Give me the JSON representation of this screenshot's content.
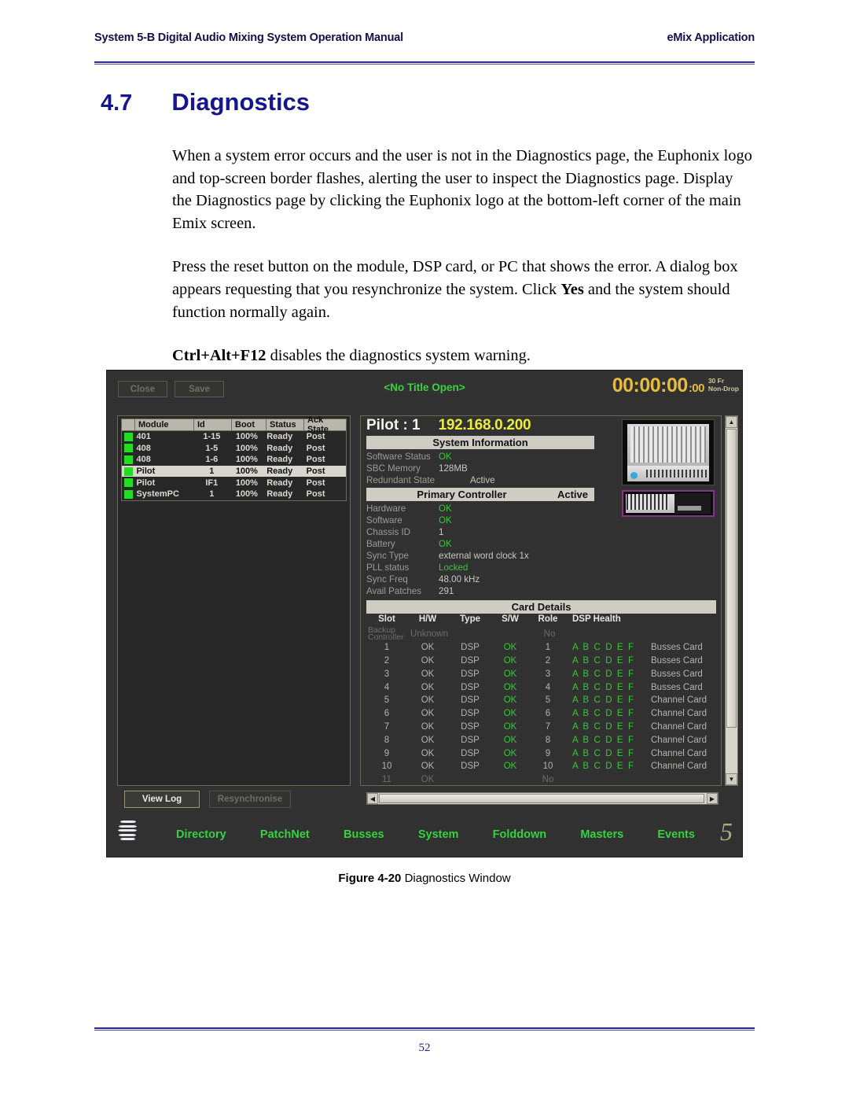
{
  "header": {
    "left": "System 5-B Digital Audio Mixing System Operation Manual",
    "right": "eMix Application"
  },
  "footer": {
    "page_number": "52"
  },
  "section": {
    "number": "4.7",
    "title": "Diagnostics"
  },
  "paragraphs": {
    "p1": "When a system error occurs and the user is not in the Diagnostics page, the Euphonix logo and top-screen border flashes, alerting the user to inspect the Diagnostics page. Display the Diagnostics page by clicking the Euphonix logo at the bottom-left corner of the main Emix screen.",
    "p2_a": "Press the reset button on the module, DSP card, or PC that shows the error. A dialog box appears requesting that you resynchronize the system. Click ",
    "p2_b": "Yes",
    "p2_c": " and the system should function normally again.",
    "p3_a": "Ctrl+Alt+F12",
    "p3_b": " disables the diagnostics system warning."
  },
  "figure": {
    "label": "Figure 4-20",
    "caption": "Diagnostics Window"
  },
  "screenshot": {
    "topbar": {
      "close_label": "Close",
      "save_label": "Save",
      "title": "<No Title Open>",
      "timecode": "00:00:00",
      "timecode_frames": ":00",
      "rate": "30 Fr",
      "drop_mode": "Non-Drop"
    },
    "module_table": {
      "columns": [
        "Module",
        "Id",
        "Boot",
        "Status",
        "Ack State"
      ],
      "rows": [
        {
          "module": "401",
          "id": "1-15",
          "boot": "100%",
          "status": "Ready",
          "ack": "Post",
          "selected": false
        },
        {
          "module": "408",
          "id": "1-5",
          "boot": "100%",
          "status": "Ready",
          "ack": "Post",
          "selected": false
        },
        {
          "module": "408",
          "id": "1-6",
          "boot": "100%",
          "status": "Ready",
          "ack": "Post",
          "selected": false
        },
        {
          "module": "Pilot",
          "id": "1",
          "boot": "100%",
          "status": "Ready",
          "ack": "Post",
          "selected": true
        },
        {
          "module": "Pilot",
          "id": "IF1",
          "boot": "100%",
          "status": "Ready",
          "ack": "Post",
          "selected": false
        },
        {
          "module": "SystemPC",
          "id": "1",
          "boot": "100%",
          "status": "Ready",
          "ack": "Post",
          "selected": false
        }
      ]
    },
    "detail": {
      "device_title": "Pilot : 1",
      "ip_address": "192.168.0.200",
      "system_information_header": "System Information",
      "system_information": [
        {
          "key": "Software Status",
          "value": "OK",
          "state": "ok"
        },
        {
          "key": "SBC Memory",
          "value": "128MB",
          "state": "normal"
        },
        {
          "key": "Redundant State",
          "value": "Active",
          "state": "normal"
        }
      ],
      "primary_controller_header": "Primary Controller",
      "primary_controller_state": "Active",
      "controller_info": [
        {
          "key": "Hardware",
          "value": "OK",
          "state": "ok"
        },
        {
          "key": "Software",
          "value": "OK",
          "state": "ok"
        },
        {
          "key": "Chassis ID",
          "value": "1",
          "state": "normal"
        },
        {
          "key": "Battery",
          "value": "OK",
          "state": "ok"
        },
        {
          "key": "Sync Type",
          "value": "external word clock 1x",
          "state": "normal"
        },
        {
          "key": "PLL status",
          "value": "Locked",
          "state": "ok"
        },
        {
          "key": "Sync Freq",
          "value": "48.00 kHz",
          "state": "normal"
        },
        {
          "key": "Avail Patches",
          "value": "291",
          "state": "normal"
        }
      ],
      "card_details_header": "Card Details",
      "card_columns": [
        "Slot",
        "H/W",
        "Type",
        "S/W",
        "Role",
        "DSP Health"
      ],
      "backup_row": {
        "slot_line1": "Backup",
        "slot_line2": "Controller",
        "hw": "Unknown",
        "role": "No"
      },
      "card_rows": [
        {
          "slot": "1",
          "hw": "OK",
          "type": "DSP",
          "sw": "OK",
          "role": "1",
          "dsp": "A B C D E F",
          "name": "Busses Card"
        },
        {
          "slot": "2",
          "hw": "OK",
          "type": "DSP",
          "sw": "OK",
          "role": "2",
          "dsp": "A B C D E F",
          "name": "Busses Card"
        },
        {
          "slot": "3",
          "hw": "OK",
          "type": "DSP",
          "sw": "OK",
          "role": "3",
          "dsp": "A B C D E F",
          "name": "Busses Card"
        },
        {
          "slot": "4",
          "hw": "OK",
          "type": "DSP",
          "sw": "OK",
          "role": "4",
          "dsp": "A B C D E F",
          "name": "Busses Card"
        },
        {
          "slot": "5",
          "hw": "OK",
          "type": "DSP",
          "sw": "OK",
          "role": "5",
          "dsp": "A B C D E F",
          "name": "Channel Card"
        },
        {
          "slot": "6",
          "hw": "OK",
          "type": "DSP",
          "sw": "OK",
          "role": "6",
          "dsp": "A B C D E F",
          "name": "Channel Card"
        },
        {
          "slot": "7",
          "hw": "OK",
          "type": "DSP",
          "sw": "OK",
          "role": "7",
          "dsp": "A B C D E F",
          "name": "Channel Card"
        },
        {
          "slot": "8",
          "hw": "OK",
          "type": "DSP",
          "sw": "OK",
          "role": "8",
          "dsp": "A B C D E F",
          "name": "Channel Card"
        },
        {
          "slot": "9",
          "hw": "OK",
          "type": "DSP",
          "sw": "OK",
          "role": "9",
          "dsp": "A B C D E F",
          "name": "Channel Card"
        },
        {
          "slot": "10",
          "hw": "OK",
          "type": "DSP",
          "sw": "OK",
          "role": "10",
          "dsp": "A B C D E F",
          "name": "Channel Card"
        },
        {
          "slot": "11",
          "hw": "OK",
          "type": "",
          "sw": "",
          "role": "No",
          "dsp": "",
          "name": ""
        }
      ]
    },
    "buttons": {
      "view_log": "View Log",
      "resynchronise": "Resynchronise"
    },
    "nav": [
      "Directory",
      "PatchNet",
      "Busses",
      "System",
      "Folddown",
      "Masters",
      "Events"
    ],
    "colors": {
      "nav_green": "#35d23f",
      "status_ok_green": "#35c935",
      "timecode_yellow": "#e8bb3c",
      "ip_yellow": "#ecec3c",
      "selection_magenta": "#8d2f8d",
      "heading_blue": "#16168e"
    }
  }
}
